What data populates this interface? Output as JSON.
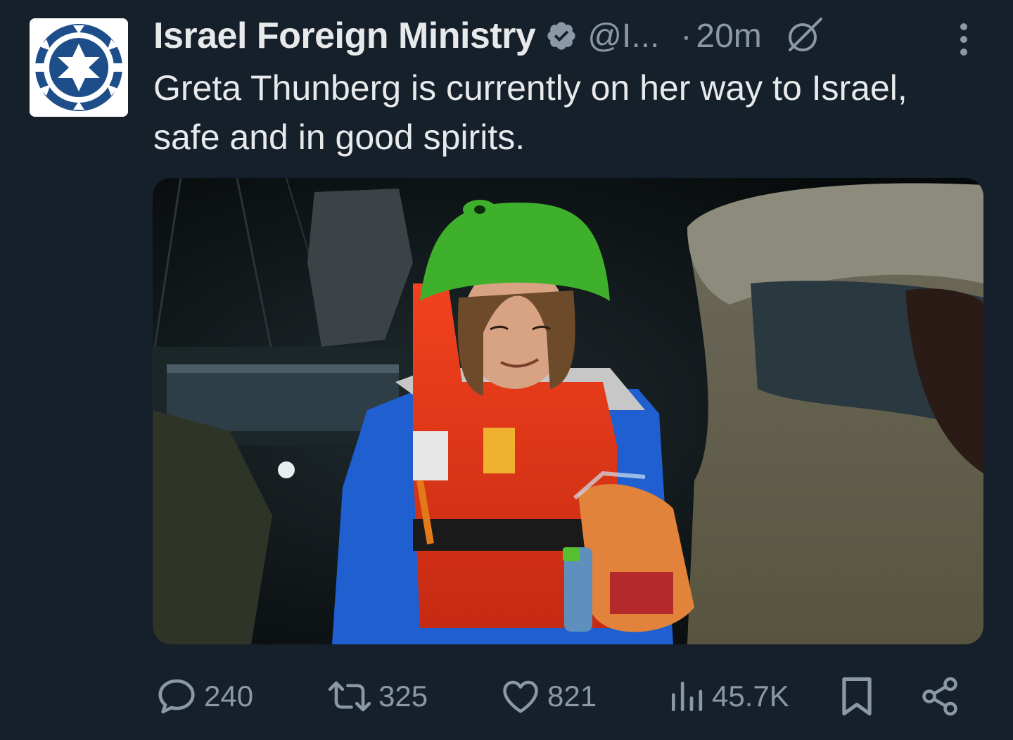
{
  "tweet": {
    "author": {
      "display_name": "Israel Foreign Ministry",
      "handle": "@I...",
      "verified": true,
      "avatar_icon": "israel-foreign-ministry-emblem",
      "avatar_colors": {
        "background": "#ffffff",
        "emblem": "#1d4e89"
      }
    },
    "separator": "·",
    "timestamp": "20m",
    "grok_icon": "grok-icon",
    "more_icon": "more-vertical-icon",
    "text": "Greta Thunberg is currently on her way to Israel, safe and in good spirits.",
    "media": {
      "type": "photo"
    },
    "actions": {
      "replies": "240",
      "reposts": "325",
      "likes": "821",
      "views": "45.7K"
    }
  },
  "theme": {
    "background": "#15202b",
    "text_primary": "#e7e9ea",
    "text_secondary": "#8b98a5",
    "verified_badge": "#8b98a5"
  }
}
